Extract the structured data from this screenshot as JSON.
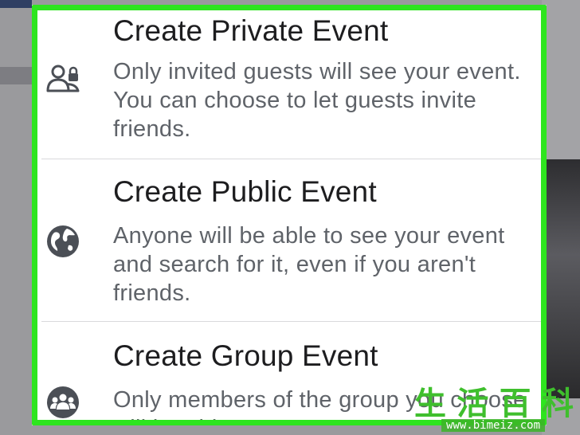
{
  "sheet": {
    "options": [
      {
        "title": "Create Private Event",
        "description": "Only invited guests will see your event. You can choose to let guests invite friends.",
        "icon": "people-lock-icon"
      },
      {
        "title": "Create Public Event",
        "description": "Anyone will be able to see your event and search for it, even if you aren't friends.",
        "icon": "globe-icon"
      },
      {
        "title": "Create Group Event",
        "description": "Only members of the group you choose will be able to see",
        "icon": "group-icon"
      }
    ]
  },
  "watermark": {
    "chars": [
      "生",
      "活",
      "百",
      "科"
    ],
    "url": "www.bimeiz.com"
  },
  "colors": {
    "highlight": "#2ee51f",
    "icon": "#4b4f56",
    "title": "#1d1d1f",
    "description": "#5f6369"
  }
}
